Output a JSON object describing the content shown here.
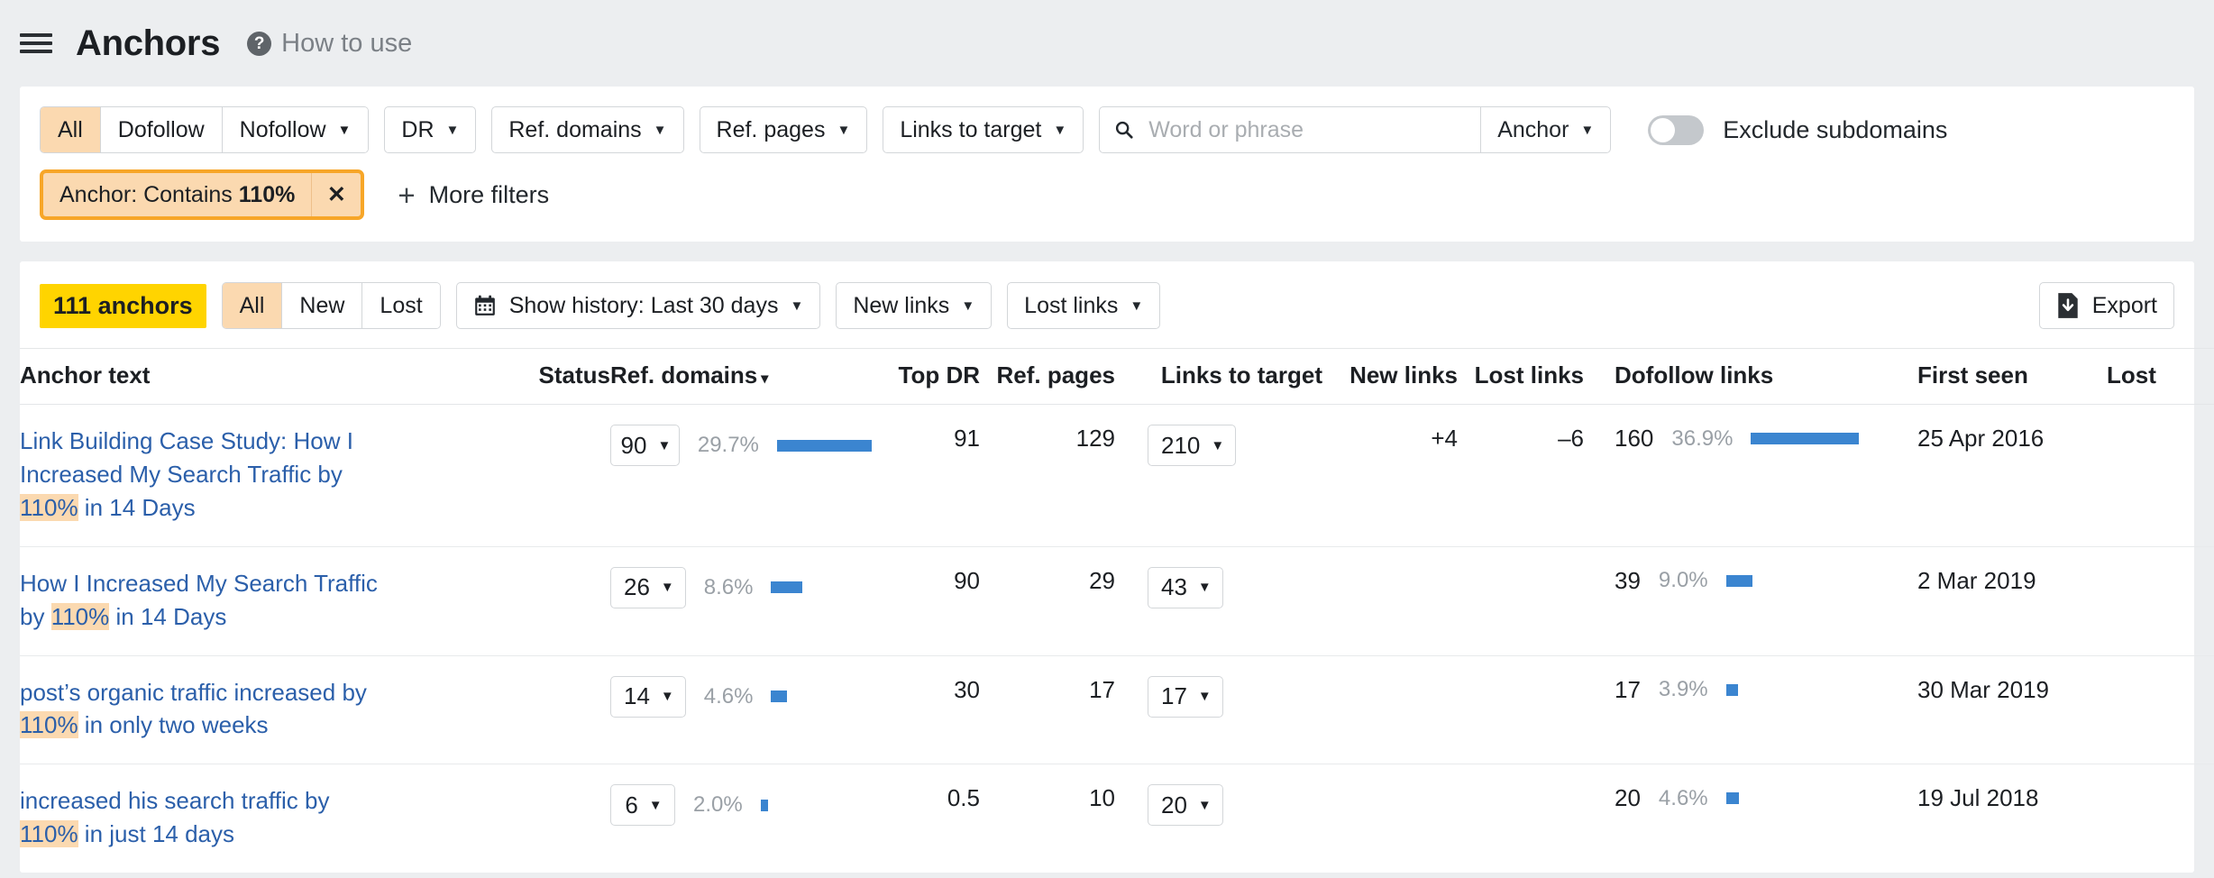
{
  "header": {
    "menu_icon": "hamburger-icon",
    "title": "Anchors",
    "help_icon": "question-mark-icon",
    "howto_label": "How to use"
  },
  "filters": {
    "follow_segments": [
      {
        "label": "All",
        "active": true
      },
      {
        "label": "Dofollow",
        "active": false
      },
      {
        "label": "Nofollow",
        "active": false,
        "caret": "▼"
      }
    ],
    "dropdowns": [
      {
        "label": "DR"
      },
      {
        "label": "Ref. domains"
      },
      {
        "label": "Ref. pages"
      },
      {
        "label": "Links to target"
      }
    ],
    "search": {
      "icon": "search-icon",
      "placeholder": "Word or phrase",
      "value": "",
      "scope_label": "Anchor"
    },
    "toggle": {
      "label": "Exclude subdomains",
      "state": "off"
    },
    "active_chip": {
      "prefix": "Anchor: Contains",
      "value": "110%",
      "close_icon": "close-icon"
    },
    "more_filters_label": "More filters",
    "plus_icon": "plus-icon"
  },
  "toolbar": {
    "count_badge": "111 anchors",
    "status_segments": [
      {
        "label": "All",
        "active": true
      },
      {
        "label": "New",
        "active": false
      },
      {
        "label": "Lost",
        "active": false
      }
    ],
    "history": {
      "icon": "calendar-icon",
      "label": "Show history: Last 30 days"
    },
    "new_links_label": "New links",
    "lost_links_label": "Lost links",
    "export": {
      "icon": "export-icon",
      "label": "Export"
    }
  },
  "table": {
    "columns": [
      "Anchor text",
      "Status",
      "Ref. domains",
      "Top DR",
      "Ref. pages",
      "Links to target",
      "New links",
      "Lost links",
      "Dofollow links",
      "First seen",
      "Lost"
    ],
    "sorted_column": "Ref. domains",
    "sort_caret": "▾",
    "rows": [
      {
        "anchor_pre": "Link Building Case Study: How I Increased My Search Traffic by ",
        "anchor_hl": "110%",
        "anchor_post": " in 14 Days",
        "status": "",
        "ref_domains": "90",
        "ref_domains_pct": "29.7%",
        "ref_domains_bar": 100,
        "top_dr": "91",
        "ref_pages": "129",
        "links_to_target": "210",
        "new_links": "+4",
        "lost_links": "–6",
        "dofollow_links": "160",
        "dofollow_pct": "36.9%",
        "dofollow_bar": 100,
        "first_seen": "25 Apr 2016",
        "lost": ""
      },
      {
        "anchor_pre": "How I Increased My Search Traffic by ",
        "anchor_hl": "110%",
        "anchor_post": " in 14 Days",
        "status": "",
        "ref_domains": "26",
        "ref_domains_pct": "8.6%",
        "ref_domains_bar": 29,
        "top_dr": "90",
        "ref_pages": "29",
        "links_to_target": "43",
        "new_links": "",
        "lost_links": "",
        "dofollow_links": "39",
        "dofollow_pct": "9.0%",
        "dofollow_bar": 24,
        "first_seen": "2 Mar 2019",
        "lost": ""
      },
      {
        "anchor_pre": "post’s organic traffic increased by ",
        "anchor_hl": "110%",
        "anchor_post": " in only two weeks",
        "status": "",
        "ref_domains": "14",
        "ref_domains_pct": "4.6%",
        "ref_domains_bar": 15,
        "top_dr": "30",
        "ref_pages": "17",
        "links_to_target": "17",
        "new_links": "",
        "lost_links": "",
        "dofollow_links": "17",
        "dofollow_pct": "3.9%",
        "dofollow_bar": 11,
        "first_seen": "30 Mar 2019",
        "lost": ""
      },
      {
        "anchor_pre": "increased his search traffic by ",
        "anchor_hl": "110%",
        "anchor_post": " in just 14 days",
        "status": "",
        "ref_domains": "6",
        "ref_domains_pct": "2.0%",
        "ref_domains_bar": 7,
        "top_dr": "0.5",
        "ref_pages": "10",
        "links_to_target": "20",
        "new_links": "",
        "lost_links": "",
        "dofollow_links": "20",
        "dofollow_pct": "4.6%",
        "dofollow_bar": 12,
        "first_seen": "19 Jul 2018",
        "lost": ""
      }
    ]
  },
  "colors": {
    "accent_orange": "#f7a628",
    "chip_fill": "#fbd9b0",
    "badge_yellow": "#ffd400",
    "bar_blue": "#3b85d0",
    "link_blue": "#2b5faa",
    "positive_green": "#1e9e4a",
    "negative_red": "#e02b20"
  }
}
